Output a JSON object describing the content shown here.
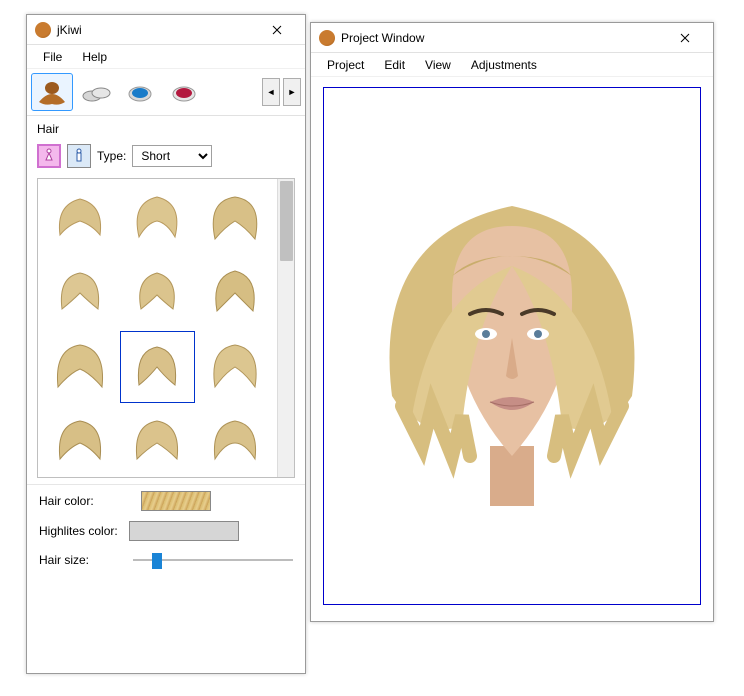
{
  "left_window": {
    "title": "jKiwi",
    "menu": {
      "file": "File",
      "help": "Help"
    },
    "tabs": {
      "hair": "hair-icon",
      "accessories": "compact-icon",
      "eyeshadow": "eyeshadow-icon",
      "lipstick": "lipstick-icon"
    },
    "section_title": "Hair",
    "gender": {
      "female": "female-icon",
      "male": "male-icon"
    },
    "type_label": "Type:",
    "type_value": "Short",
    "hair_color_label": "Hair color:",
    "highlights_label": "Highlites color:",
    "hair_size_label": "Hair size:"
  },
  "right_window": {
    "title": "Project Window",
    "menu": {
      "project": "Project",
      "edit": "Edit",
      "view": "View",
      "adjustments": "Adjustments"
    }
  }
}
